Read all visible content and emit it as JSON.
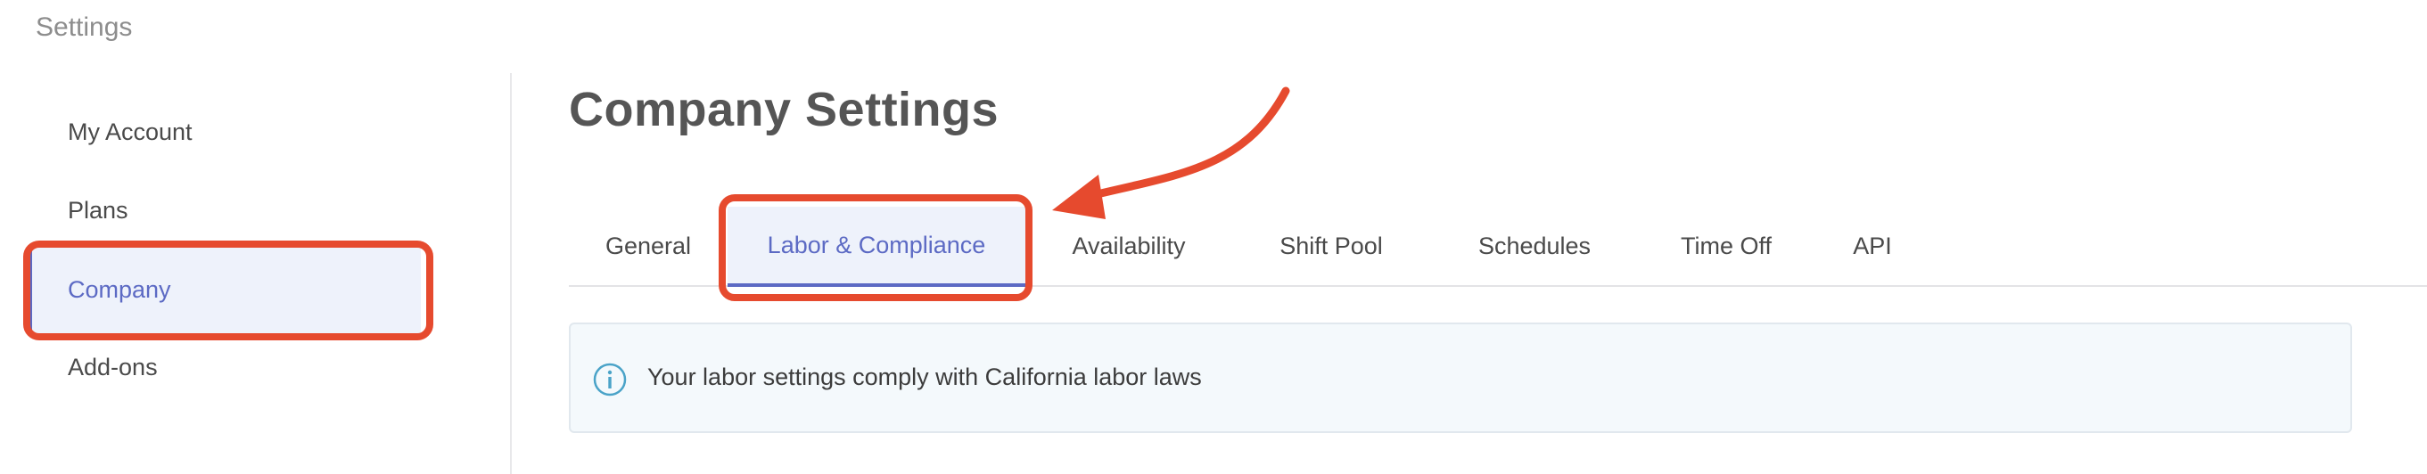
{
  "app": {
    "settings_title": "Settings"
  },
  "sidebar": {
    "items": [
      {
        "label": "My Account"
      },
      {
        "label": "Plans"
      },
      {
        "label": "Company"
      },
      {
        "label": "Add-ons"
      }
    ],
    "active_index": 2
  },
  "main": {
    "title": "Company Settings",
    "tabs": [
      {
        "label": "General"
      },
      {
        "label": "Labor & Compliance"
      },
      {
        "label": "Availability"
      },
      {
        "label": "Shift Pool"
      },
      {
        "label": "Schedules"
      },
      {
        "label": "Time Off"
      },
      {
        "label": "API"
      }
    ],
    "active_tab_index": 1,
    "notice": {
      "icon": "info-icon",
      "text": "Your labor settings comply with California labor laws"
    }
  },
  "colors": {
    "accent": "#5c6ac4",
    "active_bg": "#eef2fb",
    "annotation": "#e64a2e",
    "notice_bg": "#f4f9fc",
    "info_icon": "#4aa3c8"
  }
}
